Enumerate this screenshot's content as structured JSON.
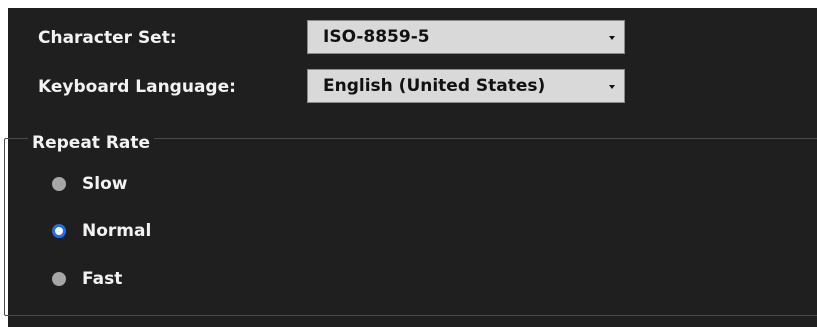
{
  "settings": {
    "character_set": {
      "label": "Character Set:",
      "value": "ISO-8859-5"
    },
    "keyboard_language": {
      "label": "Keyboard Language:",
      "value": "English (United States)"
    },
    "repeat_rate": {
      "title": "Repeat Rate",
      "options": [
        {
          "label": "Slow",
          "selected": false
        },
        {
          "label": "Normal",
          "selected": true
        },
        {
          "label": "Fast",
          "selected": false
        }
      ]
    }
  },
  "colors": {
    "panel_background": "#1f1f1f",
    "combo_background": "#d9d9d9",
    "radio_selected_accent": "#1f6fe6",
    "radio_unselected": "#a6a6a6",
    "text": "#f2f2f2"
  },
  "icons": {
    "dropdown": "chevron-down-icon"
  }
}
